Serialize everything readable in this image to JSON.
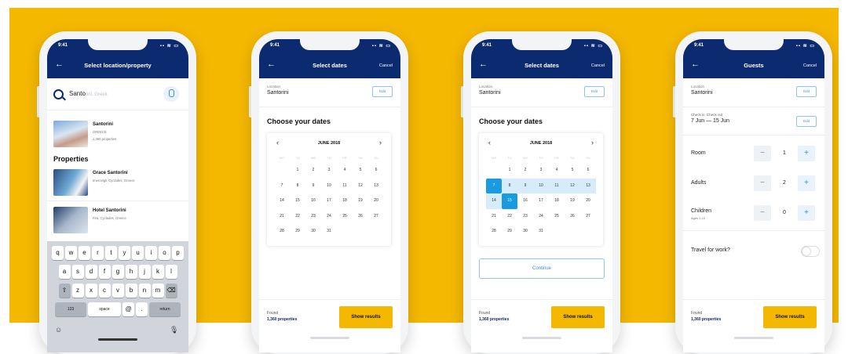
{
  "colors": {
    "background": "#f5b800",
    "navbar": "#0b2a6f",
    "accent": "#1a9ae0",
    "cta": "#f5b800"
  },
  "status": {
    "time": "9:41",
    "icons": "▪▪ ≋ ▭"
  },
  "screen1": {
    "title": "Select location/property",
    "search_value": "Santo",
    "search_placeholder": "rini, Greek",
    "location_result": {
      "name": "Santorini",
      "country": "GREECE",
      "count": "1,360 properties"
    },
    "section_title": "Properties",
    "properties": [
      {
        "name": "Grace Santorini",
        "sub": "Imerovigli, Cyclades, Greece"
      },
      {
        "name": "Hotel Santorini",
        "sub": "Fira, Cyclades, Greece"
      }
    ],
    "keyboard": {
      "row1": [
        "q",
        "w",
        "e",
        "r",
        "t",
        "y",
        "u",
        "i",
        "o",
        "p"
      ],
      "row2": [
        "a",
        "s",
        "d",
        "f",
        "g",
        "h",
        "j",
        "k",
        "l"
      ],
      "row3": [
        "z",
        "x",
        "c",
        "v",
        "b",
        "n",
        "m"
      ],
      "shift": "⇧",
      "backspace": "⌫",
      "numbers": "123",
      "space": "space",
      "at": "@",
      "period": ".",
      "return": "return",
      "emoji": "☺",
      "mic": "🎙"
    }
  },
  "screen2": {
    "title": "Select dates",
    "cancel": "Cancel",
    "location_label": "Location",
    "location_value": "Santorini",
    "edit": "Edit",
    "choose_title": "Choose your dates",
    "month": "JUNE 2018",
    "found_label": "Found",
    "found_count": "1,360 properties",
    "show_results": "Show results"
  },
  "screen3": {
    "title": "Select dates",
    "cancel": "Cancel",
    "location_label": "Location",
    "location_value": "Santorini",
    "edit": "Edit",
    "choose_title": "Choose your dates",
    "month": "JUNE 2018",
    "continue": "Continue",
    "found_label": "Found",
    "found_count": "1,360 properties",
    "show_results": "Show results"
  },
  "screen4": {
    "title": "Guests",
    "cancel": "Cancel",
    "location_label": "Location",
    "location_value": "Santorini",
    "checkin_label": "Check in",
    "checkout_label": "Check out",
    "dates_value": "7 Jun — 15 Jun",
    "edit": "Edit",
    "room_label": "Room",
    "room_value": "1",
    "adults_label": "Adults",
    "adults_value": "2",
    "children_label": "Children",
    "children_sub": "Ages 2-12",
    "children_value": "0",
    "travel_label": "Travel for work?",
    "found_label": "Found",
    "found_count": "1,360 properties",
    "show_results": "Show results"
  },
  "calendar": {
    "weekdays": [
      "MO",
      "TU",
      "WE",
      "TH",
      "FR",
      "SA",
      "SU"
    ],
    "weeks": [
      [
        "",
        "",
        "",
        "",
        "",
        "",
        ""
      ],
      [
        "",
        "1",
        "2",
        "3",
        "4",
        "5",
        "6"
      ],
      [
        "7",
        "8",
        "9",
        "10",
        "11",
        "12",
        "13"
      ],
      [
        "14",
        "15",
        "16",
        "17",
        "18",
        "19",
        "20"
      ],
      [
        "21",
        "22",
        "23",
        "24",
        "25",
        "26",
        "27"
      ],
      [
        "28",
        "29",
        "30",
        "31",
        "",
        "",
        ""
      ]
    ]
  },
  "selection": {
    "start": "7",
    "end": "15"
  }
}
